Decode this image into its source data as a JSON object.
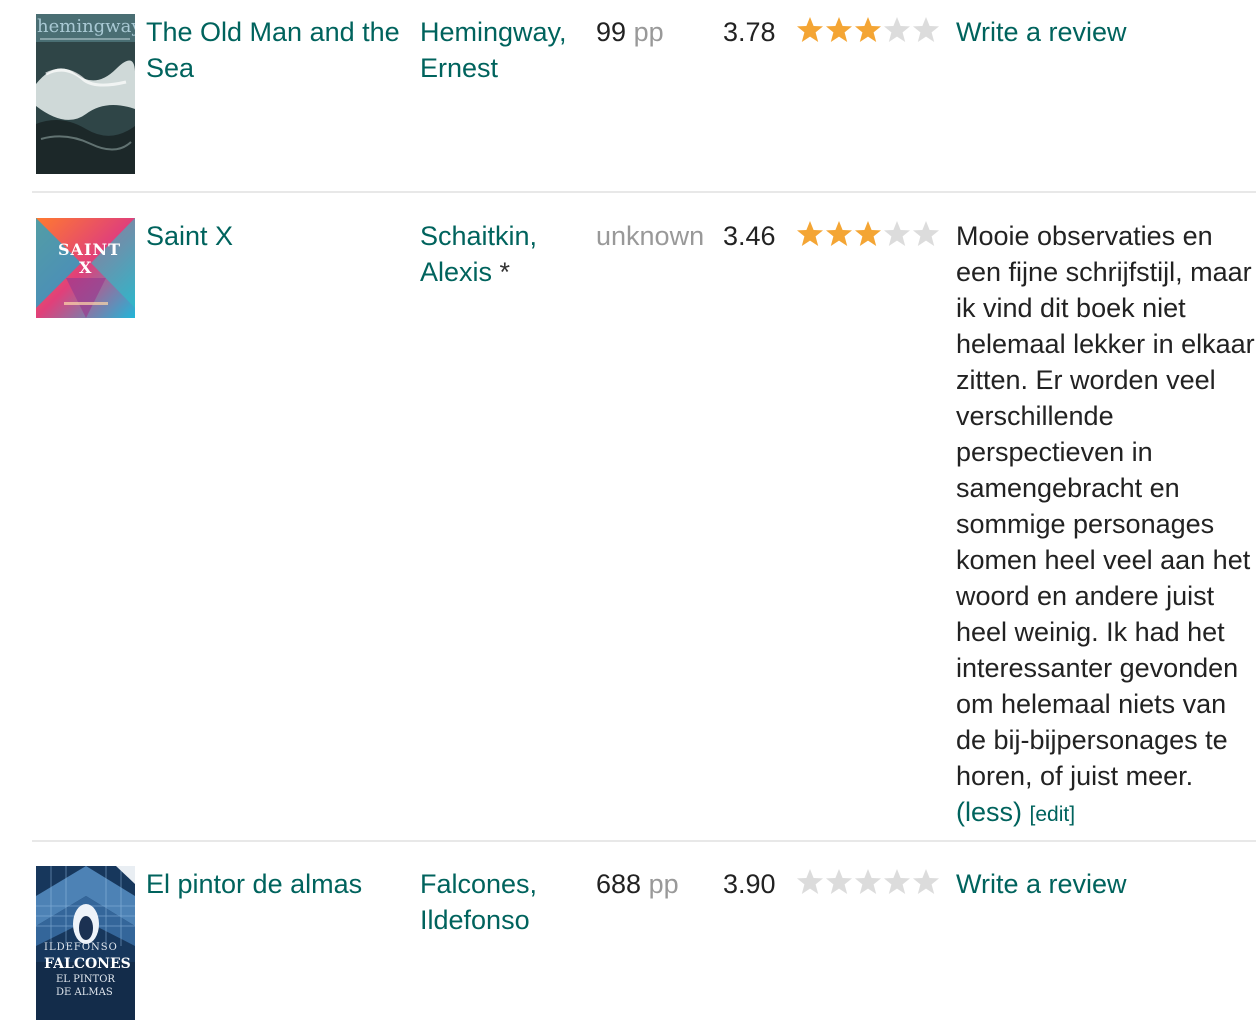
{
  "books": [
    {
      "title": "The Old Man and the Sea",
      "author": "Hemingway, Ernest",
      "author_marker": "",
      "pages_num": "99",
      "pages_unit": "pp",
      "avg_rating": "3.78",
      "user_rating": 3,
      "review_action": "Write a review",
      "cover": {
        "icon": "book-cover-image",
        "text_lines": [
          "hemingway"
        ],
        "colors": [
          "#3a4f52",
          "#d9e2e0",
          "#1e2b2c"
        ]
      }
    },
    {
      "title": "Saint X",
      "author": "Schaitkin, Alexis",
      "author_marker": "*",
      "pages_num": "",
      "pages_unit": "",
      "pages_unknown": "unknown",
      "avg_rating": "3.46",
      "user_rating": 3,
      "review_text": "Mooie observaties en een fijne schrijfstijl, maar ik vind dit boek niet helemaal lekker in elkaar zitten. Er worden veel verschillende perspectieven in samengebracht en sommige personages komen heel veel aan het woord en andere juist heel weinig. Ik had het interessanter gevonden om helemaal niets van de bij-bijpersonages te horen, of juist meer.",
      "less_label": "(less)",
      "edit_label": "[edit]",
      "cover": {
        "icon": "book-cover-image",
        "text_lines": [
          "SAINT",
          "X"
        ],
        "colors": [
          "#f0574a",
          "#21b3d6",
          "#7a3b7e"
        ]
      }
    },
    {
      "title": "El pintor de almas",
      "author": "Falcones, Ildefonso",
      "author_marker": "",
      "pages_num": "688",
      "pages_unit": "pp",
      "avg_rating": "3.90",
      "user_rating": 0,
      "review_action": "Write a review",
      "cover": {
        "icon": "book-cover-image",
        "text_lines": [
          "ILDEFONSO",
          "FALCONES",
          "EL PINTOR",
          "DE ALMAS"
        ],
        "colors": [
          "#1c3d64",
          "#4f86bf",
          "#e8eef5"
        ]
      }
    }
  ],
  "star_colors": {
    "filled": "#f4a534",
    "empty": "#dcdcdc"
  }
}
